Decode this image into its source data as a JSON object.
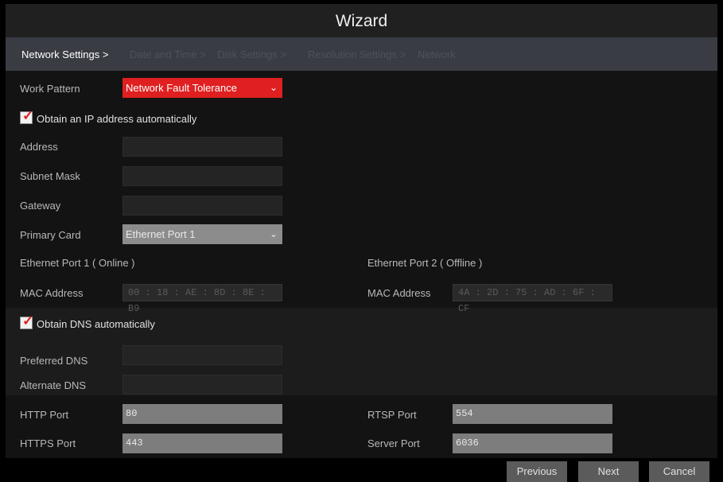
{
  "window": {
    "title": "Wizard"
  },
  "steps": {
    "active": "Network Settings >",
    "inactive": [
      "Date and Time >",
      "Disk Settings >",
      "Resolution Settings >",
      "Network"
    ]
  },
  "form": {
    "work_pattern": {
      "label": "Work Pattern",
      "value": "Network Fault Tolerance"
    },
    "obtain_ip": {
      "label": "Obtain an IP address automatically",
      "checked": true
    },
    "address": {
      "label": "Address"
    },
    "subnet": {
      "label": "Subnet Mask"
    },
    "gateway": {
      "label": "Gateway"
    },
    "primary_card": {
      "label": "Primary Card",
      "value": "Ethernet Port 1"
    },
    "port1": {
      "heading": "Ethernet Port 1 ( Online )",
      "mac_label": "MAC Address",
      "mac": "00 : 18 : AE : 8D : 8E : B9"
    },
    "port2": {
      "heading": "Ethernet Port 2 ( Offline )",
      "mac_label": "MAC Address",
      "mac": "4A : 2D : 75 : AD : 6F : CF"
    },
    "obtain_dns": {
      "label": "Obtain DNS automatically",
      "checked": true
    },
    "preferred_dns": {
      "label": "Preferred DNS"
    },
    "alternate_dns": {
      "label": "Alternate DNS"
    },
    "http": {
      "label": "HTTP Port",
      "value": "80"
    },
    "https": {
      "label": "HTTPS Port",
      "value": "443"
    },
    "rtsp": {
      "label": "RTSP Port",
      "value": "554"
    },
    "server": {
      "label": "Server Port",
      "value": "6036"
    },
    "ip_separator": "."
  },
  "buttons": {
    "previous": "Previous",
    "next": "Next",
    "cancel": "Cancel"
  },
  "colors": {
    "accent": "#e02020",
    "title_bg": "#202020",
    "step_bg": "#3a3c44"
  }
}
